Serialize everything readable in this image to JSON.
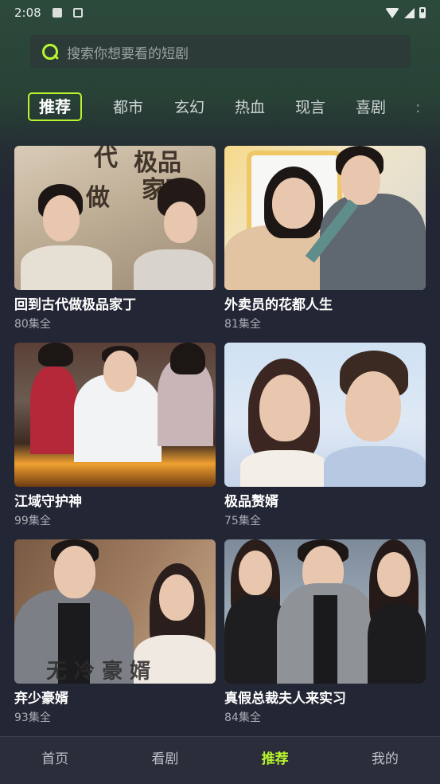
{
  "status_bar": {
    "time": "2:08"
  },
  "search": {
    "placeholder": "搜索你想要看的短剧"
  },
  "categories": [
    "推荐",
    "都市",
    "玄幻",
    "热血",
    "现言",
    "喜剧"
  ],
  "active_category": "推荐",
  "dramas": [
    {
      "title": "回到古代做极品家丁",
      "episodes": "80集全"
    },
    {
      "title": "外卖员的花都人生",
      "episodes": "81集全"
    },
    {
      "title": "江域守护神",
      "episodes": "99集全"
    },
    {
      "title": "极品赘婿",
      "episodes": "75集全"
    },
    {
      "title": "弃少豪婿",
      "episodes": "93集全"
    },
    {
      "title": "真假总裁夫人来实习",
      "episodes": "84集全"
    }
  ],
  "bottom_nav": [
    "首页",
    "看剧",
    "推荐",
    "我的"
  ],
  "active_nav": "推荐",
  "colors": {
    "accent": "#b8f52e",
    "background": "#232634",
    "nav_background": "#2b2e3a"
  }
}
